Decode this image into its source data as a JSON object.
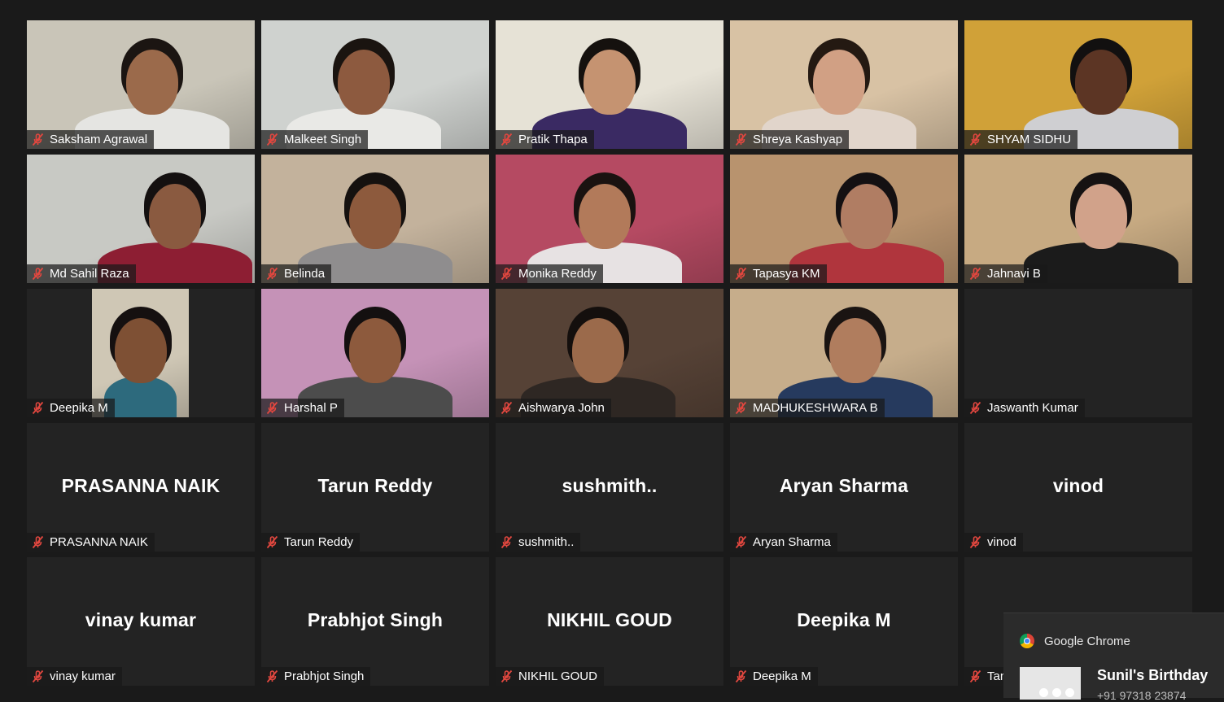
{
  "participants": [
    {
      "name": "Saksham Agrawal",
      "video": true,
      "bg": "#c9c5b8",
      "shirt": "#e5e5e2",
      "skin": "#9b6a4b",
      "hair": "#1b1512",
      "head_x": 0.55
    },
    {
      "name": "Malkeet Singh",
      "video": true,
      "bg": "#cfd2cf",
      "shirt": "#e9e9e6",
      "skin": "#8d5a3f",
      "hair": "#1a1410",
      "head_x": 0.45
    },
    {
      "name": "Pratik Thapa",
      "video": true,
      "bg": "#e6e2d6",
      "shirt": "#3a2a63",
      "skin": "#c59371",
      "hair": "#15110e",
      "head_x": 0.5
    },
    {
      "name": "Shreya Kashyap",
      "video": true,
      "bg": "#d8c2a4",
      "shirt": "#e1d5cb",
      "skin": "#d1a084",
      "hair": "#241912",
      "head_x": 0.48
    },
    {
      "name": "SHYAM SIDHU",
      "video": true,
      "bg": "#d0a138",
      "shirt": "#cfcfd2",
      "skin": "#5c3524",
      "hair": "#121010",
      "head_x": 0.6
    },
    {
      "name": "Md Sahil Raza",
      "video": true,
      "bg": "#c8c9c4",
      "shirt": "#8d1e33",
      "skin": "#8a5a40",
      "hair": "#141010",
      "head_x": 0.65
    },
    {
      "name": "Belinda",
      "video": true,
      "bg": "#c3b29c",
      "shirt": "#8f8d8e",
      "skin": "#8d5a3d",
      "hair": "#15110f",
      "head_x": 0.5
    },
    {
      "name": "Monika Reddy",
      "video": true,
      "bg": "#b54a62",
      "shirt": "#e7e2e3",
      "skin": "#b27a5a",
      "hair": "#1a1210",
      "head_x": 0.48
    },
    {
      "name": "Tapasya KM",
      "video": true,
      "bg": "#b8936e",
      "shirt": "#b0353d",
      "skin": "#b07d63",
      "hair": "#141012",
      "head_x": 0.6
    },
    {
      "name": "Jahnavi B",
      "video": true,
      "bg": "#c7aa82",
      "shirt": "#1b1b1b",
      "skin": "#d1a28a",
      "hair": "#161212",
      "head_x": 0.6
    },
    {
      "name": "Deepika M",
      "video": true,
      "narrow": true,
      "bg": "#cfc7b5",
      "shirt": "#2d6a7d",
      "skin": "#7e5034",
      "hair": "#151010",
      "head_x": 0.5
    },
    {
      "name": "Harshal P",
      "video": true,
      "bg": "#c592b7",
      "shirt": "#4c4c4c",
      "skin": "#8d5a3d",
      "hair": "#141010",
      "head_x": 0.5
    },
    {
      "name": "Aishwarya John",
      "video": true,
      "bg": "#564236",
      "shirt": "#2e2723",
      "skin": "#9b6a4b",
      "hair": "#140f0d",
      "head_x": 0.45
    },
    {
      "name": "MADHUKESHWARA B",
      "video": true,
      "bg": "#c6ad8b",
      "shirt": "#263a5e",
      "skin": "#b07d5e",
      "hair": "#1a1412",
      "head_x": 0.55
    },
    {
      "name": "Jaswanth Kumar",
      "video": false
    },
    {
      "name": "PRASANNA NAIK",
      "video": false,
      "display": "PRASANNA NAIK"
    },
    {
      "name": "Tarun Reddy",
      "video": false,
      "display": "Tarun Reddy"
    },
    {
      "name": "sushmith..",
      "video": false,
      "display": "sushmith.."
    },
    {
      "name": "Aryan Sharma",
      "video": false,
      "display": "Aryan Sharma"
    },
    {
      "name": "vinod",
      "video": false,
      "display": "vinod"
    },
    {
      "name": "vinay kumar",
      "video": false,
      "display": "vinay kumar"
    },
    {
      "name": "Prabhjot Singh",
      "video": false,
      "display": "Prabhjot Singh"
    },
    {
      "name": "NIKHIL GOUD",
      "video": false,
      "display": "NIKHIL GOUD"
    },
    {
      "name": "Deepika M",
      "video": false,
      "display": "Deepika M"
    },
    {
      "name": "Tanvi P",
      "video": false
    }
  ],
  "notification": {
    "app": "Google Chrome",
    "title": "Sunil's Birthday",
    "subtitle": "+91 97318 23874"
  }
}
